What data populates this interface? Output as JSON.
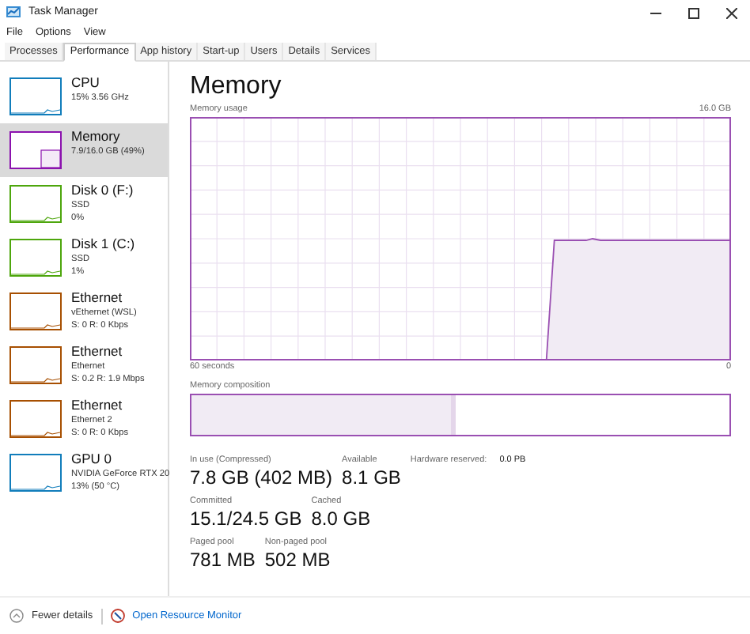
{
  "window": {
    "title": "Task Manager"
  },
  "menu": [
    "File",
    "Options",
    "View"
  ],
  "tabs": [
    {
      "label": "Processes",
      "selected": false
    },
    {
      "label": "Performance",
      "selected": true
    },
    {
      "label": "App history",
      "selected": false
    },
    {
      "label": "Start-up",
      "selected": false
    },
    {
      "label": "Users",
      "selected": false
    },
    {
      "label": "Details",
      "selected": false
    },
    {
      "label": "Services",
      "selected": false
    }
  ],
  "sidebar": {
    "items": [
      {
        "name": "CPU",
        "details": [
          "15% 3.56 GHz"
        ],
        "color": "#117dbb",
        "selected": false
      },
      {
        "name": "Memory",
        "details": [
          "7.9/16.0 GB (49%)"
        ],
        "color": "#8b12ae",
        "selected": true
      },
      {
        "name": "Disk 0 (F:)",
        "details": [
          "SSD",
          "0%"
        ],
        "color": "#4da60c",
        "selected": false
      },
      {
        "name": "Disk 1 (C:)",
        "details": [
          "SSD",
          "1%"
        ],
        "color": "#4da60c",
        "selected": false
      },
      {
        "name": "Ethernet",
        "details": [
          "vEthernet (WSL)",
          "S: 0 R: 0 Kbps"
        ],
        "color": "#a74f01",
        "selected": false
      },
      {
        "name": "Ethernet",
        "details": [
          "Ethernet",
          "S: 0.2 R: 1.9 Mbps"
        ],
        "color": "#a74f01",
        "selected": false
      },
      {
        "name": "Ethernet",
        "details": [
          "Ethernet 2",
          "S: 0 R: 0 Kbps"
        ],
        "color": "#a74f01",
        "selected": false
      },
      {
        "name": "GPU 0",
        "details": [
          "NVIDIA GeForce RTX 20",
          "13% (50 °C)"
        ],
        "color": "#117dbb",
        "selected": false
      }
    ]
  },
  "main": {
    "title": "Memory",
    "graph": {
      "label": "Memory usage",
      "max": "16.0 GB",
      "left_axis": "60 seconds",
      "right_axis": "0"
    },
    "composition": {
      "label": "Memory composition",
      "level": 0.49
    },
    "stats": [
      [
        {
          "label": "In use (Compressed)",
          "value": "7.8 GB (402 MB)"
        },
        {
          "label": "Available",
          "value": "8.1 GB"
        },
        {
          "label": "Hardware reserved:",
          "small_value": "0.0 PB"
        }
      ],
      [
        {
          "label": "Committed",
          "value": "15.1/24.5 GB"
        },
        {
          "label": "Cached",
          "value": "8.0 GB"
        }
      ],
      [
        {
          "label": "Paged pool",
          "value": "781 MB"
        },
        {
          "label": "Non-paged pool",
          "value": "502 MB"
        }
      ]
    ]
  },
  "footer": {
    "fewer_details": "Fewer details",
    "link": "Open Resource Monitor"
  }
}
